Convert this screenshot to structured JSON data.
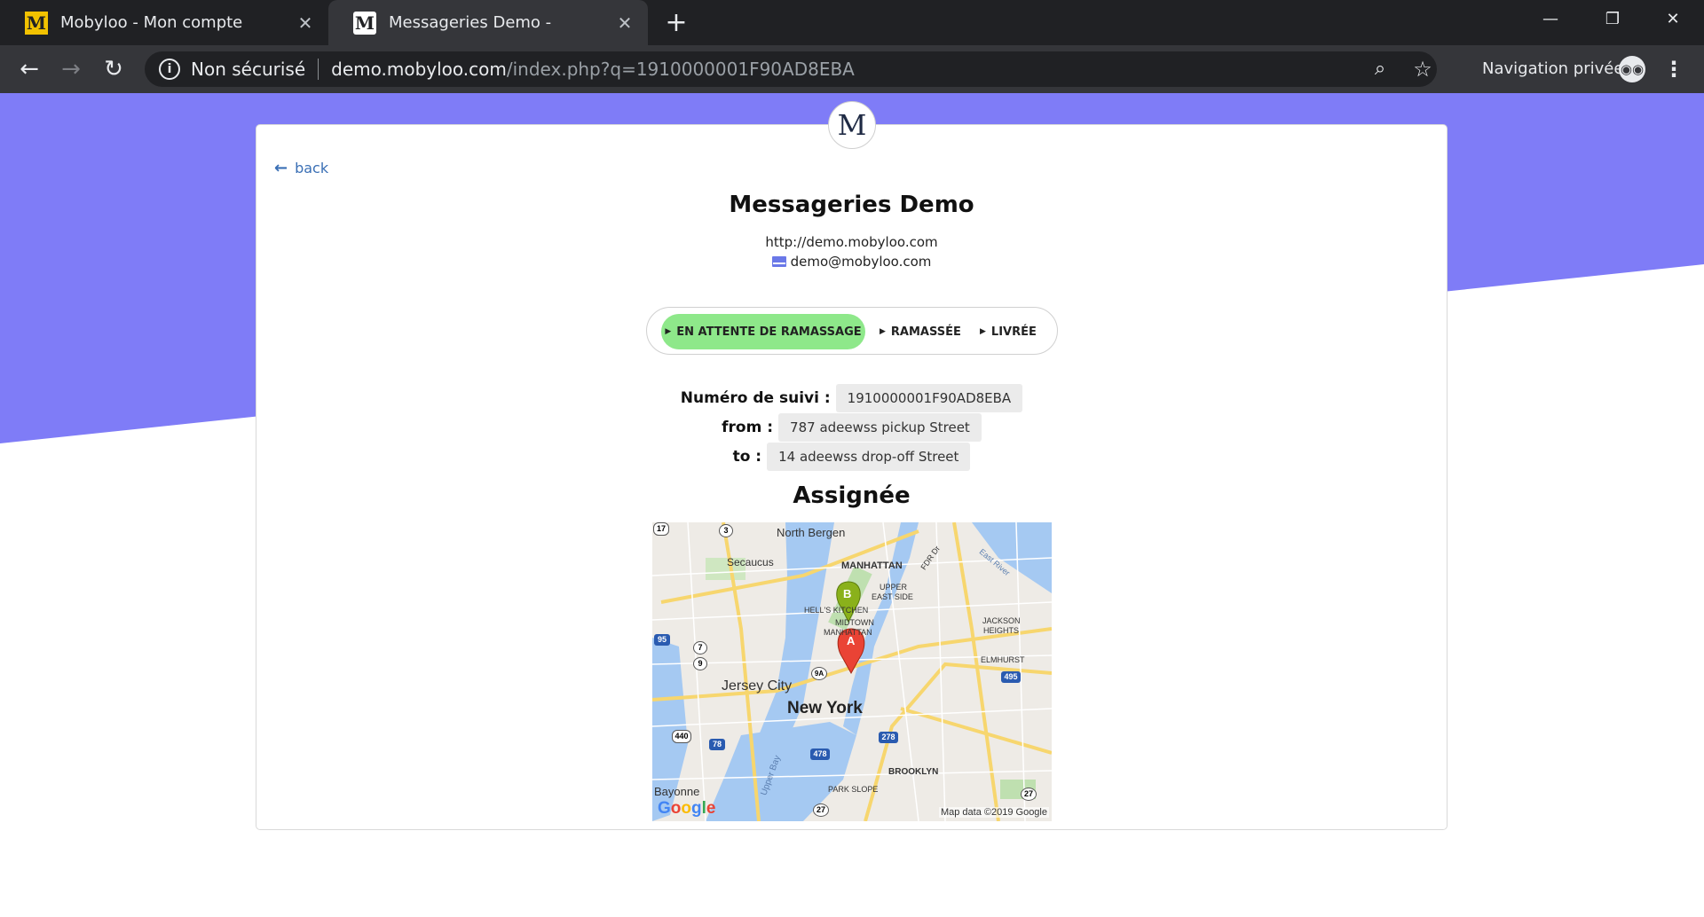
{
  "browser": {
    "tabs": [
      {
        "title": "Mobyloo - Mon compte",
        "favicon": "mobyloo-yellow-icon",
        "favicon_glyph": "M",
        "close": "✕"
      },
      {
        "title": "Messageries Demo -",
        "favicon": "mobyloo-m-logo-icon",
        "favicon_glyph": "M",
        "close": "✕"
      }
    ],
    "new_tab": "+",
    "window_controls": {
      "minimize": "—",
      "restore": "❐",
      "close": "✕"
    },
    "nav": {
      "back": "←",
      "forward": "→",
      "reload": "↻"
    },
    "address": {
      "security_label": "Non sécurisé",
      "domain": "demo.mobyloo.com",
      "path": "/index.php?q=1910000001F90AD8EBA"
    },
    "zoom_icon": "⌕",
    "star_icon": "☆",
    "incognito_label": "Navigation privée",
    "incognito_glyph": "◉◉",
    "menu_icon": "⋮"
  },
  "page": {
    "colors": {
      "header_band": "#7f7cf7",
      "active_step": "#8ee88a",
      "link": "#3a6fb5"
    },
    "logo_glyph": "M",
    "back_label": "back",
    "company_name": "Messageries Demo",
    "website": "http://demo.mobyloo.com",
    "email": "demo@mobyloo.com",
    "status_steps": [
      {
        "label": "EN ATTENTE DE RAMASSAGE",
        "active": true
      },
      {
        "label": "RAMASSÉE",
        "active": false
      },
      {
        "label": "LIVRÉE",
        "active": false
      }
    ],
    "tracking": {
      "number_label": "Numéro de suivi :",
      "number_value": "1910000001F90AD8EBA",
      "from_label": "from :",
      "from_value": "787 adeewss pickup Street",
      "to_label": "to :",
      "to_value": "14 adeewss drop-off Street"
    },
    "assignee_title": "Assignée",
    "map": {
      "labels": {
        "north_bergen": "North Bergen",
        "secaucus": "Secaucus",
        "manhattan": "MANHATTAN",
        "fdr": "FDR Dr",
        "east_river": "East River",
        "upper_east_side_1": "UPPER",
        "upper_east_side_2": "EAST SIDE",
        "hells_kitchen": "HELL'S KITCHEN",
        "midtown_1": "MIDTOWN",
        "midtown_2": "MANHATTAN",
        "jackson_1": "JACKSON",
        "jackson_2": "HEIGHTS",
        "elmhurst": "ELMHURST",
        "jersey_city": "Jersey City",
        "new_york": "New York",
        "brooklyn": "BROOKLYN",
        "park_slope": "PARK SLOPE",
        "bayonne": "Bayonne",
        "upper_bay": "Upper Bay"
      },
      "shields": {
        "r17": "17",
        "r3": "3",
        "i95": "95",
        "r7": "7",
        "r9": "9",
        "r9a": "9A",
        "r440": "440",
        "i78": "78",
        "i478": "478",
        "i278": "278",
        "i495": "495",
        "r27a": "27",
        "r27b": "27"
      },
      "markers": {
        "b": "B",
        "a": "A"
      },
      "google": "Google",
      "credit": "Map data ©2019 Google"
    }
  }
}
